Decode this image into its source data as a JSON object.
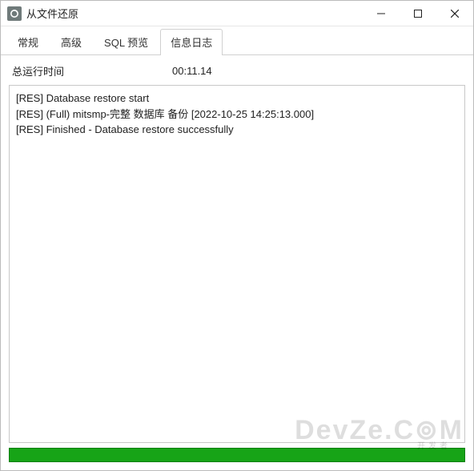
{
  "window": {
    "title": "从文件还原"
  },
  "tabs": [
    {
      "label": "常规",
      "active": false
    },
    {
      "label": "高级",
      "active": false
    },
    {
      "label": "SQL 预览",
      "active": false
    },
    {
      "label": "信息日志",
      "active": true
    }
  ],
  "runtime": {
    "label": "总运行时间",
    "value": "00:11.14"
  },
  "log_lines": [
    "[RES] Database restore start",
    "[RES] (Full) mitsmp-完整 数据库 备份 [2022-10-25 14:25:13.000]",
    "[RES] Finished - Database restore successfully"
  ],
  "progress": {
    "percent": 100,
    "color": "#17a417"
  },
  "watermark": {
    "main": "DevZe.C⊚M",
    "sub": "开发者"
  }
}
